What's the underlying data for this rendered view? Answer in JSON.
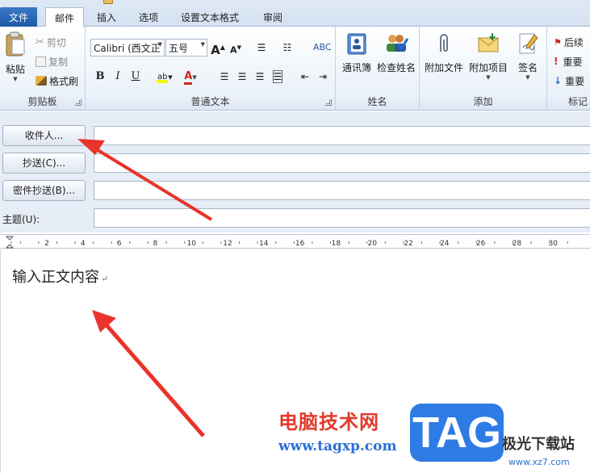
{
  "tabs": {
    "file": "文件",
    "mail": "邮件",
    "insert": "插入",
    "options": "选项",
    "format_text": "设置文本格式",
    "review": "审阅"
  },
  "ribbon": {
    "clipboard": {
      "paste": "粘贴",
      "cut": "剪切",
      "copy": "复制",
      "format_painter": "格式刷",
      "group_label": "剪贴板"
    },
    "basic_text": {
      "font": "Calibri (西文正",
      "size": "五号",
      "grow": "A",
      "shrink": "A",
      "bold": "B",
      "italic": "I",
      "underline": "U",
      "font_color": "A",
      "group_label": "普通文本"
    },
    "names": {
      "address_book": "通讯簿",
      "check_names": "检查姓名",
      "group_label": "姓名"
    },
    "include": {
      "attach_file": "附加文件",
      "attach_item": "附加项目",
      "signature": "签名",
      "group_label": "添加"
    },
    "tags": {
      "follow_up": "后续",
      "high_importance": "重要",
      "low_importance": "重要",
      "group_label": "标记"
    }
  },
  "address": {
    "to_button": "收件人...",
    "cc_button": "抄送(C)...",
    "bcc_button": "密件抄送(B)...",
    "subject_label": "主题(U):"
  },
  "ruler": {
    "ticks": [
      "2",
      "4",
      "6",
      "8",
      "10",
      "12",
      "14",
      "16",
      "18",
      "20",
      "22",
      "24",
      "26",
      "28",
      "30"
    ]
  },
  "body": {
    "text": "输入正文内容",
    "para_mark": "↵"
  },
  "watermark": {
    "site_name": "电脑技术网",
    "site_url": "www.tagxp.com",
    "badge": "TAG",
    "brand": "极光下载站",
    "brand_url": "www.xz7.com"
  },
  "colors": {
    "accent": "#2b579a",
    "file_tab": "#2a66b8",
    "arrow": "#e8342a",
    "tag_badge": "#2e7be6"
  }
}
